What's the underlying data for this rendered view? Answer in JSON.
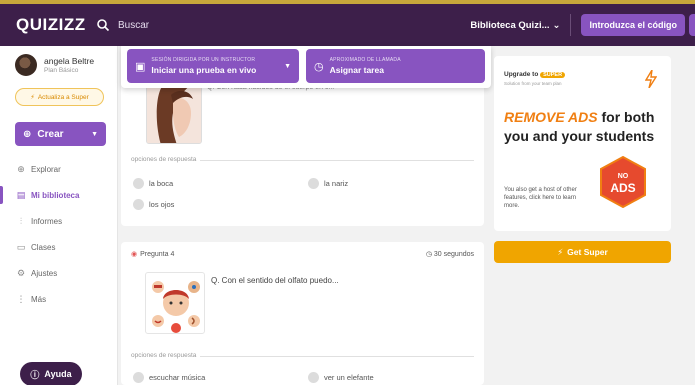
{
  "app": {
    "logo": "QUIZIZZ"
  },
  "search": {
    "placeholder": "Buscar"
  },
  "header": {
    "library_label": "Biblioteca Quizi...",
    "code_button": "Introduzca el código"
  },
  "sidebar": {
    "user_name": "angela Beltre",
    "user_plan": "Plan Básico",
    "super_button": "Actualiza a Super",
    "create_button": "Crear",
    "items": [
      {
        "label": "Explorar",
        "icon": "compass-icon",
        "active": false
      },
      {
        "label": "Mi biblioteca",
        "icon": "library-icon",
        "active": true
      },
      {
        "label": "Informes",
        "icon": "reports-icon",
        "active": false
      },
      {
        "label": "Clases",
        "icon": "classes-icon",
        "active": false
      },
      {
        "label": "Ajustes",
        "icon": "settings-icon",
        "active": false
      },
      {
        "label": "Más",
        "icon": "more-icon",
        "active": false
      }
    ],
    "help_button": "Ayuda"
  },
  "launch": {
    "live": {
      "caption": "SESIÓN DIRIGIDA POR UN INSTRUCTOR",
      "label": "Iniciar una prueba en vivo"
    },
    "assign": {
      "caption": "APROXIMADO DE LLAMADA",
      "label": "Asignar tarea"
    }
  },
  "question1": {
    "text": "Q. Con nada nacidos de el cuerpo en c...",
    "answers_label": "opciones de respuesta",
    "options": [
      "la boca",
      "la nariz",
      "los ojos"
    ]
  },
  "question2": {
    "number": "Pregunta 4",
    "time": "30 segundos",
    "text": "Q. Con el sentido del olfato puedo...",
    "answers_label": "opciones de respuesta",
    "options": [
      "escuchar música",
      "ver un elefante"
    ]
  },
  "ad": {
    "upgrade_text": "Upgrade to",
    "upgrade_pill": "SUPER",
    "sub": "Solution from your team plan",
    "remove_ads": "REMOVE ADS",
    "headline_rest": "for both you and your students",
    "description": "You also get a host of other features, click here to learn more.",
    "hex_line1": "NO",
    "hex_line2": "ADS",
    "get_super": "Get Super"
  },
  "colors": {
    "purple": "#8854c0",
    "topbar": "#3d1f4a",
    "orange": "#f0a500"
  }
}
